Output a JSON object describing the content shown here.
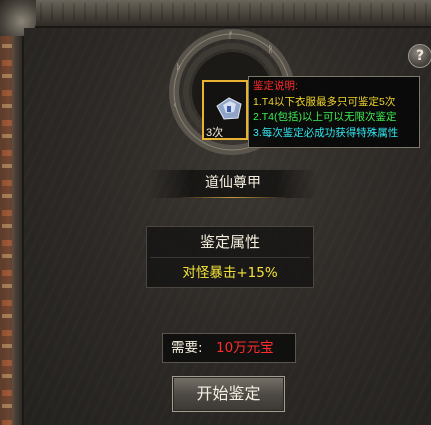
{
  "help": {
    "label": "?"
  },
  "item": {
    "count_label": "3次",
    "name": "道仙尊甲"
  },
  "tooltip": {
    "title": "鉴定说明:",
    "lines": [
      "1.T4以下衣服最多只可鉴定5次",
      "2.T4(包括)以上可以无限次鉴定",
      "3.每次鉴定必成功获得特殊属性"
    ]
  },
  "attributes": {
    "heading": "鉴定属性",
    "value": "对怪暴击+15%"
  },
  "cost": {
    "label": "需要:",
    "value": "10万元宝"
  },
  "actions": {
    "start_label": "开始鉴定"
  },
  "colors": {
    "gold": "#e7b331",
    "red": "#ff2d2d",
    "yellow": "#f5e33a",
    "green": "#3cf050",
    "cyan": "#2fe6ee"
  }
}
